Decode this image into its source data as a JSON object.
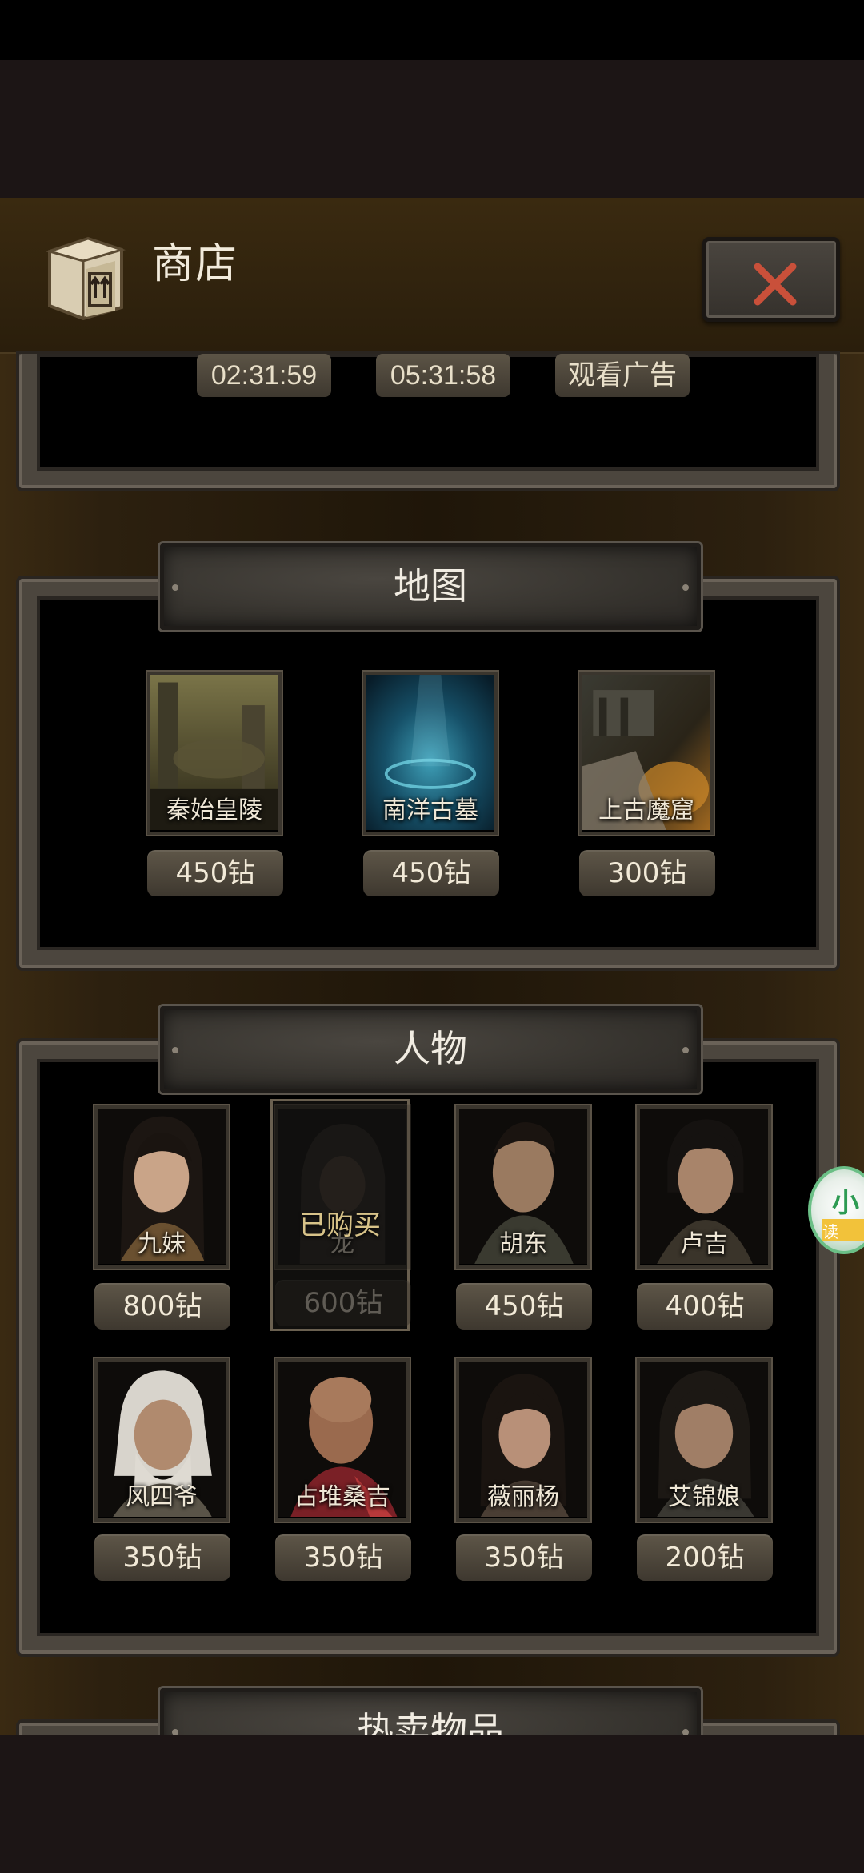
{
  "header": {
    "title": "商店",
    "close_icon": "close-icon",
    "box_icon": "box-icon"
  },
  "timers": [
    {
      "label": "02:31:59"
    },
    {
      "label": "05:31:58"
    },
    {
      "label": "观看广告"
    }
  ],
  "sections": {
    "maps": {
      "title": "地图"
    },
    "characters": {
      "title": "人物"
    },
    "hot_items": {
      "title": "热卖物品"
    }
  },
  "maps": [
    {
      "name": "秦始皇陵",
      "price": "450钻"
    },
    {
      "name": "南洋古墓",
      "price": "450钻"
    },
    {
      "name": "上古魔窟",
      "price": "300钻"
    }
  ],
  "characters": [
    {
      "name": "九妹",
      "price": "800钻"
    },
    {
      "name": "龙",
      "price": "600钻",
      "status": "已购买"
    },
    {
      "name": "胡东",
      "price": "450钻"
    },
    {
      "name": "卢吉",
      "price": "400钻"
    },
    {
      "name": "风四爷",
      "price": "350钻"
    },
    {
      "name": "占堆桑吉",
      "price": "350钻"
    },
    {
      "name": "薇丽杨",
      "price": "350钻"
    },
    {
      "name": "艾锦娘",
      "price": "200钻"
    }
  ],
  "side_widget": {
    "glyph": "小",
    "sub": "读"
  },
  "colors": {
    "close_x": "#c9503a",
    "accent_text": "#f2ead8",
    "owned_label": "#d8c389"
  }
}
